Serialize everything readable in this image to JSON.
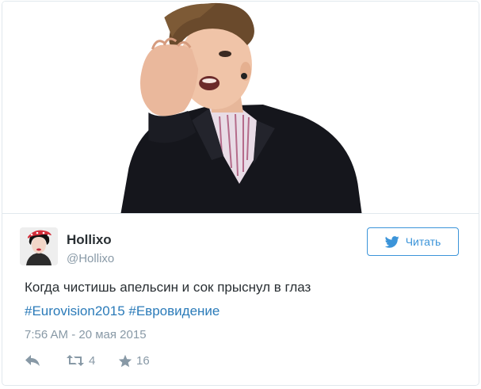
{
  "tweet": {
    "author": {
      "name": "Hollixo",
      "handle": "@Hollixo"
    },
    "follow_button": {
      "label": "Читать",
      "icon": "twitter-bird-icon"
    },
    "text": "Когда чистишь апельсин и сок прыснул в глаз",
    "hashtags": [
      "#Eurovision2015",
      "#Евровидение"
    ],
    "timestamp": "7:56 AM - 20 мая 2015",
    "actions": {
      "reply": {
        "icon": "reply-icon"
      },
      "retweet": {
        "icon": "retweet-icon",
        "count": "4"
      },
      "favorite": {
        "icon": "star-icon",
        "count": "16"
      }
    }
  },
  "colors": {
    "link": "#2b7bb9",
    "follow_accent": "#3b94d9",
    "muted": "#8899a6",
    "text": "#292f33",
    "border": "#e1e8ed"
  }
}
